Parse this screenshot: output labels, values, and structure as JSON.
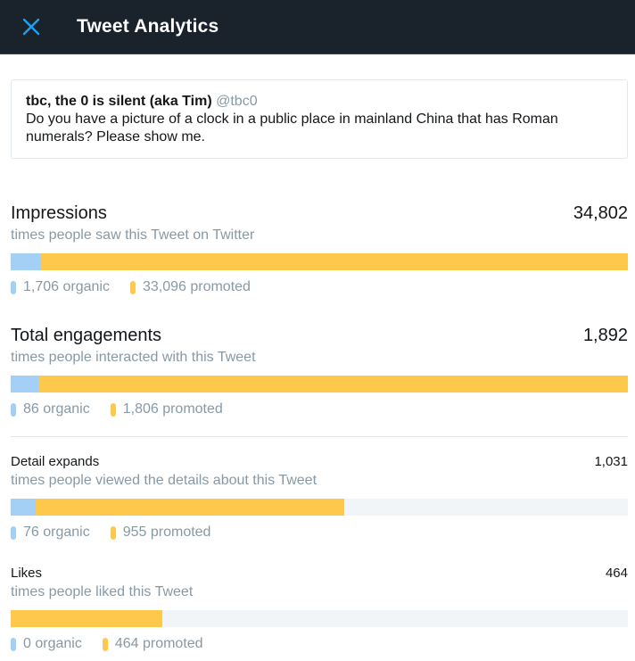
{
  "header": {
    "title": "Tweet Analytics",
    "close_icon": "close-icon",
    "background": "#1a222c",
    "accent": "#1da1f2"
  },
  "tweet": {
    "author": "tbc, the 0 is silent (aka Tim)",
    "handle": "@tbc0",
    "text": "Do you have a picture of a clock in a public place in mainland China that has Roman numerals? Please show me."
  },
  "colors": {
    "organic": "#a4d0f5",
    "promoted": "#fdc84c",
    "track": "#f2f5f7"
  },
  "stats": [
    {
      "label": "Impressions",
      "value": "34,802",
      "description": "times people saw this Tweet on Twitter",
      "organic": 1706,
      "promoted": 33096,
      "organic_label": "1,706 organic",
      "promoted_label": "33,096 promoted"
    },
    {
      "label": "Total engagements",
      "value": "1,892",
      "description": "times people interacted with this Tweet",
      "organic": 86,
      "promoted": 1806,
      "organic_label": "86 organic",
      "promoted_label": "1,806 promoted"
    },
    {
      "label": "Detail expands",
      "value": "1,031",
      "description": "times people viewed the details about this Tweet",
      "organic": 76,
      "promoted": 955,
      "organic_label": "76 organic",
      "promoted_label": "955 promoted"
    },
    {
      "label": "Likes",
      "value": "464",
      "description": "times people liked this Tweet",
      "organic": 0,
      "promoted": 464,
      "organic_label": "0 organic",
      "promoted_label": "464 promoted"
    }
  ]
}
